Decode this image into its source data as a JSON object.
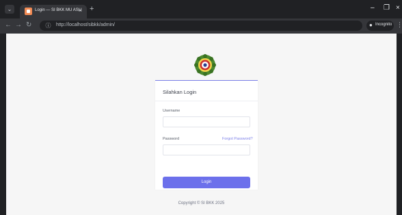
{
  "browser": {
    "tab": {
      "title": "Login — SI BKK MU ASLI",
      "close_glyph": "×"
    },
    "new_tab_glyph": "+",
    "url": "http://localhost/sibkk/admin/",
    "profile_label": "Incognito",
    "window_controls": [
      "–",
      "❐",
      "×"
    ]
  },
  "page": {
    "login_title": "Silahkan Login",
    "username_label": "Username",
    "username_value": "",
    "password_label": "Password",
    "password_value": "",
    "forgot_label": "Forgot Password?",
    "login_button": "Login",
    "copyright": "Copyright © SI BKK 2025"
  },
  "colors": {
    "accent": "#6c70eb",
    "page_background": "#f6f6f6",
    "browser_chrome": "#35363a"
  },
  "icons": [
    "tab-search-icon",
    "favicon-icon",
    "close-icon",
    "new-tab-icon",
    "back-icon",
    "forward-icon",
    "reload-icon",
    "site-info-icon",
    "incognito-icon",
    "menu-icon",
    "logo-emblem"
  ]
}
